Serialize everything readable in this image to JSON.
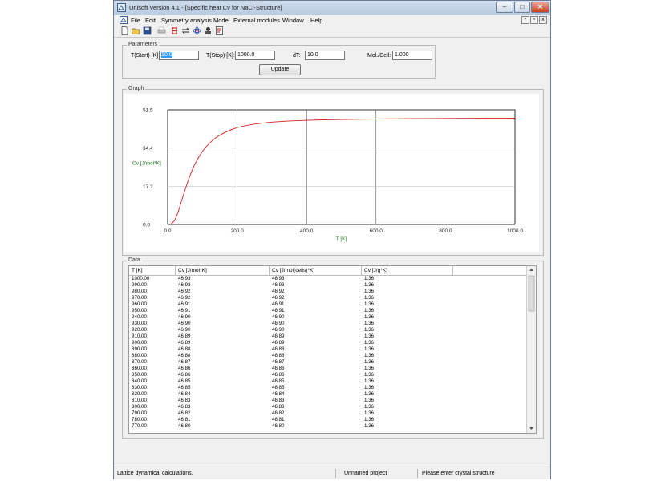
{
  "window": {
    "title": "Unisoft Version 4.1 - [Specific heat Cv for NaCl-Structure]",
    "controls": {
      "minimize": "–",
      "maximize": "□",
      "close": "✕"
    }
  },
  "menu": {
    "items": [
      "File",
      "Edit",
      "Symmetry analysis",
      "Model",
      "External modules",
      "Window",
      "Help"
    ],
    "mdi": {
      "minimize": "-",
      "restore": "▫",
      "close": "x"
    }
  },
  "toolbar": {
    "icons": [
      "new-document-icon",
      "open-folder-icon",
      "save-disk-icon",
      "print-icon",
      "crystal-lattice-icon",
      "double-arrow-icon",
      "atom-icon",
      "phonon-icon",
      "document-calc-icon"
    ]
  },
  "parameters": {
    "group_label": "Parameters",
    "t_start_label": "T(Start) [K]:",
    "t_start_value": "10.0",
    "t_stop_label": "T(Stop) [K]:",
    "t_stop_value": "1000.0",
    "dt_label": "dT:",
    "dt_value": "10.0",
    "mol_cell_label": "Mol./Cell:",
    "mol_cell_value": "1.000",
    "update_label": "Update"
  },
  "graph": {
    "group_label": "Graph"
  },
  "chart_data": {
    "type": "line",
    "xlabel": "T [K]",
    "ylabel": "Cv [J/mol*K]",
    "xlim": [
      0,
      1000
    ],
    "ylim": [
      0,
      51.5
    ],
    "xticks": [
      "0.0",
      "200.0",
      "400.0",
      "600.0",
      "800.0",
      "1000.0"
    ],
    "yticks": [
      "0.0",
      "17.2",
      "34.4",
      "51.5"
    ],
    "grid": "vertical at 200, 400, 600; horizontal at 17.2, 34.4",
    "colors": {
      "curve": "#d42020",
      "axis_label": "#1a7a1a"
    },
    "series": [
      {
        "x": [
          10,
          20,
          30,
          40,
          50,
          60,
          70,
          80,
          90,
          100,
          110,
          120,
          130,
          140,
          150,
          160,
          180,
          200,
          225,
          250,
          275,
          300,
          350,
          400,
          450,
          500,
          600,
          700,
          800,
          900,
          1000
        ],
        "values": [
          0.2,
          1.8,
          5.5,
          10.5,
          15.6,
          20.2,
          24.2,
          27.6,
          30.4,
          32.8,
          34.8,
          36.5,
          37.9,
          39.1,
          40.1,
          41.0,
          42.4,
          43.5,
          44.4,
          45.1,
          45.6,
          46.0,
          46.5,
          46.8,
          47.0,
          47.15,
          47.35,
          47.5,
          47.6,
          47.68,
          47.73
        ]
      }
    ]
  },
  "data": {
    "group_label": "Data",
    "columns": [
      "T [K]",
      "Cv [J/mol*K]",
      "Cv [J/mol(cells)*K]",
      "Cv [J/g*K]"
    ],
    "rows": [
      [
        "1000.00",
        "46.93",
        "46.93",
        "1.36"
      ],
      [
        "990.00",
        "46.93",
        "46.93",
        "1.36"
      ],
      [
        "980.00",
        "46.92",
        "46.92",
        "1.36"
      ],
      [
        "970.00",
        "46.92",
        "46.92",
        "1.36"
      ],
      [
        "960.00",
        "46.91",
        "46.91",
        "1.36"
      ],
      [
        "950.00",
        "46.91",
        "46.91",
        "1.36"
      ],
      [
        "940.00",
        "46.90",
        "46.90",
        "1.36"
      ],
      [
        "930.00",
        "46.90",
        "46.90",
        "1.36"
      ],
      [
        "920.00",
        "46.90",
        "46.90",
        "1.36"
      ],
      [
        "910.00",
        "46.89",
        "46.89",
        "1.36"
      ],
      [
        "900.00",
        "46.89",
        "46.89",
        "1.36"
      ],
      [
        "890.00",
        "46.88",
        "46.88",
        "1.36"
      ],
      [
        "880.00",
        "46.88",
        "46.88",
        "1.36"
      ],
      [
        "870.00",
        "46.87",
        "46.87",
        "1.36"
      ],
      [
        "860.00",
        "46.86",
        "46.86",
        "1.36"
      ],
      [
        "850.00",
        "46.86",
        "46.86",
        "1.36"
      ],
      [
        "840.00",
        "46.85",
        "46.85",
        "1.36"
      ],
      [
        "830.00",
        "46.85",
        "46.85",
        "1.36"
      ],
      [
        "820.00",
        "46.84",
        "46.84",
        "1.36"
      ],
      [
        "810.00",
        "46.83",
        "46.83",
        "1.36"
      ],
      [
        "800.00",
        "46.83",
        "46.83",
        "1.36"
      ],
      [
        "790.00",
        "46.82",
        "46.82",
        "1.36"
      ],
      [
        "780.00",
        "46.81",
        "46.81",
        "1.36"
      ],
      [
        "770.00",
        "46.80",
        "46.80",
        "1.36"
      ]
    ]
  },
  "statusbar": {
    "left": "Lattice dynamical calculations.",
    "middle": "Unnamed project",
    "right": "Please enter crystal structure"
  }
}
